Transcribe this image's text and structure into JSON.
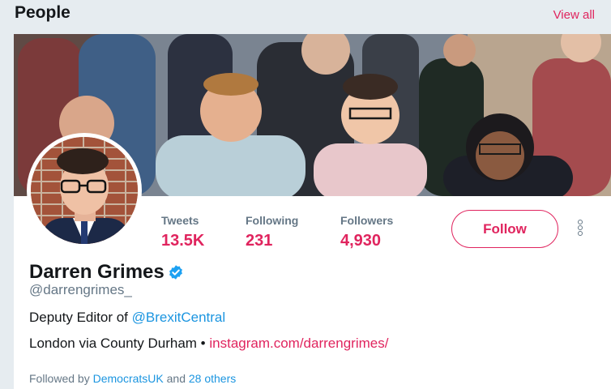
{
  "header": {
    "title": "People",
    "view_all": "View all"
  },
  "profile": {
    "name": "Darren Grimes",
    "handle": "@darrengrimes_",
    "stats": [
      {
        "label": "Tweets",
        "value": "13.5K"
      },
      {
        "label": "Following",
        "value": "231"
      },
      {
        "label": "Followers",
        "value": "4,930"
      }
    ],
    "follow_label": "Follow",
    "bio": {
      "line1_prefix": "Deputy Editor of ",
      "line1_mention": "@BrexitCentral",
      "line2_prefix": "London via County Durham • ",
      "line2_link": "instagram.com/darrengrimes/"
    },
    "followed_by": {
      "prefix": "Followed by ",
      "first": "DemocratsUK",
      "middle": " and ",
      "others": "28 others"
    }
  },
  "colors": {
    "accent": "#e0245e",
    "link": "#1b95e0",
    "muted": "#657786",
    "background": "#e6ecf0"
  },
  "icons": {
    "verified": "verified-badge-icon",
    "more": "more-vertical-icon"
  }
}
